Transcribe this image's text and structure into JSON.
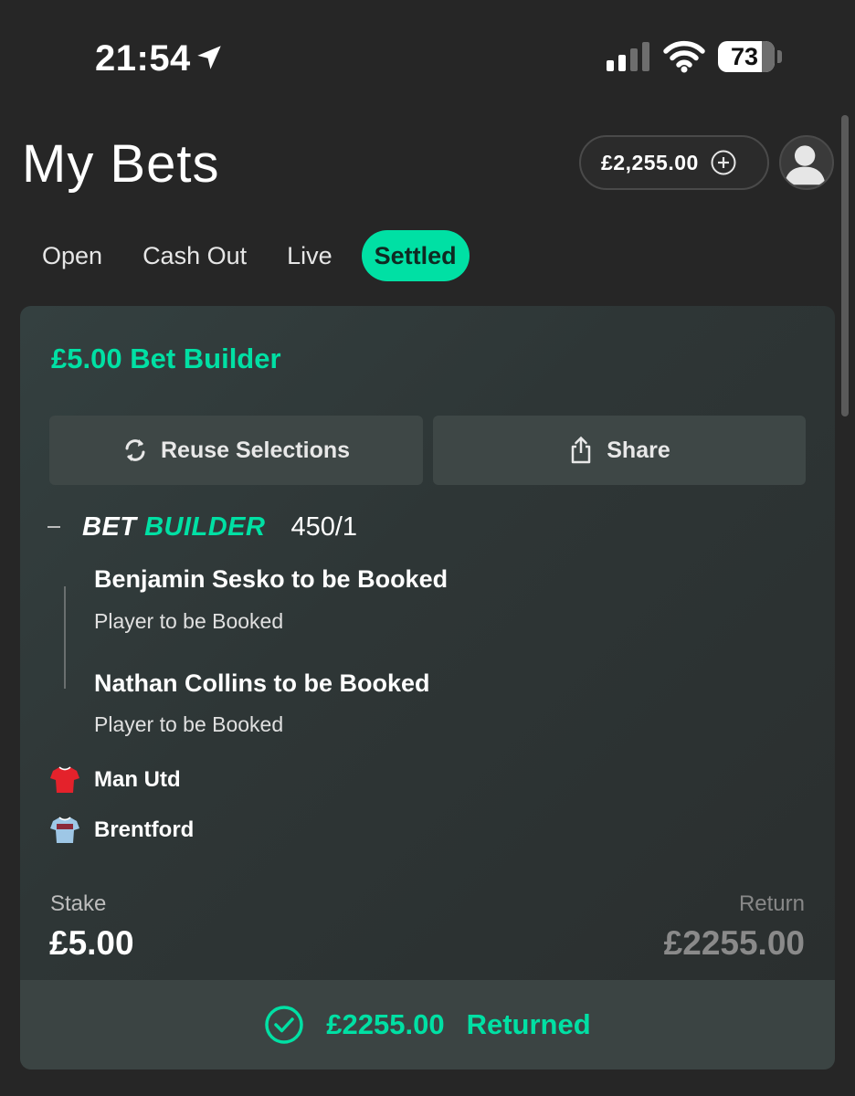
{
  "status_bar": {
    "time": "21:54",
    "battery": "73",
    "battery_level_percent": 73,
    "icons": [
      "location-arrow-icon",
      "signal-icon",
      "wifi-icon",
      "battery-icon"
    ]
  },
  "header": {
    "title": "My Bets",
    "balance": "£2,255.00",
    "icons": [
      "add-funds-icon",
      "user-avatar-icon"
    ]
  },
  "tabs": [
    {
      "label": "Open",
      "active": false
    },
    {
      "label": "Cash Out",
      "active": false
    },
    {
      "label": "Live",
      "active": false
    },
    {
      "label": "Settled",
      "active": true
    }
  ],
  "bet": {
    "title": "£5.00 Bet Builder",
    "reuse_label": "Reuse Selections",
    "share_label": "Share",
    "builder_word1": "BET",
    "builder_word2": "BUILDER",
    "odds": "450/1",
    "legs": [
      {
        "title": "Benjamin Sesko to be Booked",
        "market": "Player to be Booked"
      },
      {
        "title": "Nathan Collins to be Booked",
        "market": "Player to be Booked"
      }
    ],
    "teams": [
      {
        "name": "Man Utd",
        "shirt_color": "#e4222b"
      },
      {
        "name": "Brentford",
        "shirt_color": "#9ec7e6"
      }
    ],
    "stake_label": "Stake",
    "stake_value": "£5.00",
    "return_label": "Return",
    "return_value": "£2255.00",
    "returned_amount": "£2255.00",
    "returned_word": "Returned"
  },
  "colors": {
    "accent": "#00e0a4",
    "background": "#262626",
    "card": "#2e3636"
  }
}
